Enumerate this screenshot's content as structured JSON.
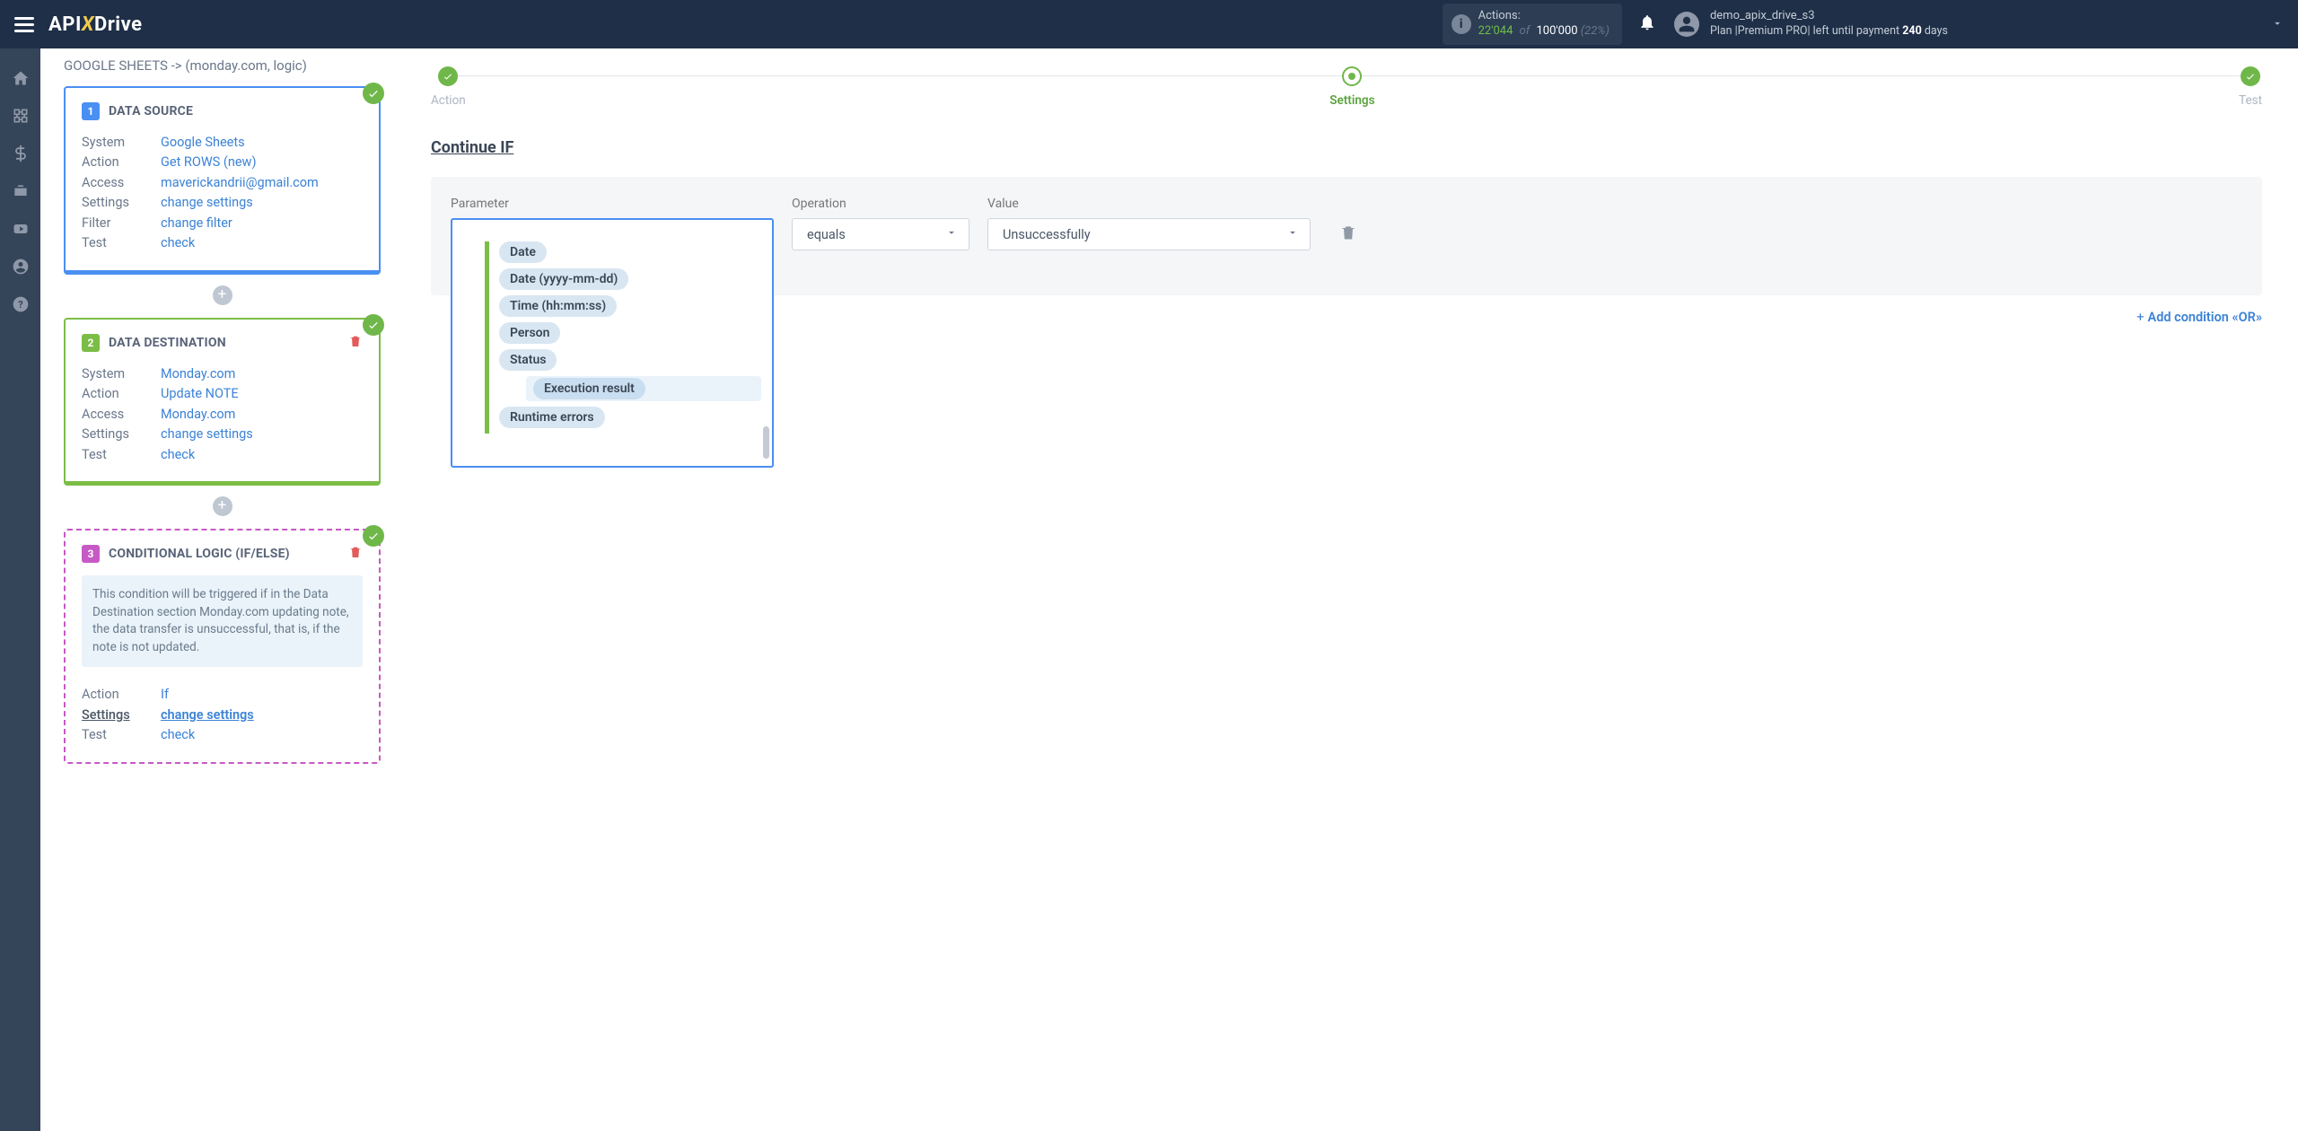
{
  "header": {
    "logo_prefix": "API",
    "logo_x": "X",
    "logo_suffix": "Drive",
    "actions_label": "Actions:",
    "actions_used": "22'044",
    "actions_of": "of",
    "actions_total": "100'000",
    "actions_pct": "(22%)",
    "username": "demo_apix_drive_s3",
    "plan_text": "Plan |Premium PRO| left until payment",
    "plan_days": "240",
    "plan_days_suffix": "days"
  },
  "breadcrumb": "GOOGLE SHEETS -> (monday.com, logic)",
  "cards": {
    "source": {
      "num": "1",
      "title": "DATA SOURCE",
      "rows": {
        "system_k": "System",
        "system_v": "Google Sheets",
        "action_k": "Action",
        "action_v": "Get ROWS (new)",
        "access_k": "Access",
        "access_v": "maverickandrii@gmail.com",
        "settings_k": "Settings",
        "settings_v": "change settings",
        "filter_k": "Filter",
        "filter_v": "change filter",
        "test_k": "Test",
        "test_v": "check"
      }
    },
    "dest": {
      "num": "2",
      "title": "DATA DESTINATION",
      "rows": {
        "system_k": "System",
        "system_v": "Monday.com",
        "action_k": "Action",
        "action_v": "Update NOTE",
        "access_k": "Access",
        "access_v": "Monday.com",
        "settings_k": "Settings",
        "settings_v": "change settings",
        "test_k": "Test",
        "test_v": "check"
      }
    },
    "logic": {
      "num": "3",
      "title": "CONDITIONAL LOGIC (IF/ELSE)",
      "info": "This condition will be triggered if in the Data Destination section Monday.com updating note, the data transfer is unsuccessful, that is, if the note is not updated.",
      "rows": {
        "action_k": "Action",
        "action_v": "If",
        "settings_k": "Settings",
        "settings_v": "change settings",
        "test_k": "Test",
        "test_v": "check"
      }
    }
  },
  "stepper": {
    "action": "Action",
    "settings": "Settings",
    "test": "Test"
  },
  "section_title": "Continue IF",
  "cond": {
    "parameter_label": "Parameter",
    "operation_label": "Operation",
    "value_label": "Value",
    "parameter_value": "Execution result",
    "operation_value": "equals",
    "value_value": "Unsuccessfully",
    "add_or": "Add condition «OR»"
  },
  "dropdown_options": [
    "Date",
    "Date (yyyy-mm-dd)",
    "Time (hh:mm:ss)",
    "Person",
    "Status",
    "Execution result",
    "Runtime errors"
  ]
}
